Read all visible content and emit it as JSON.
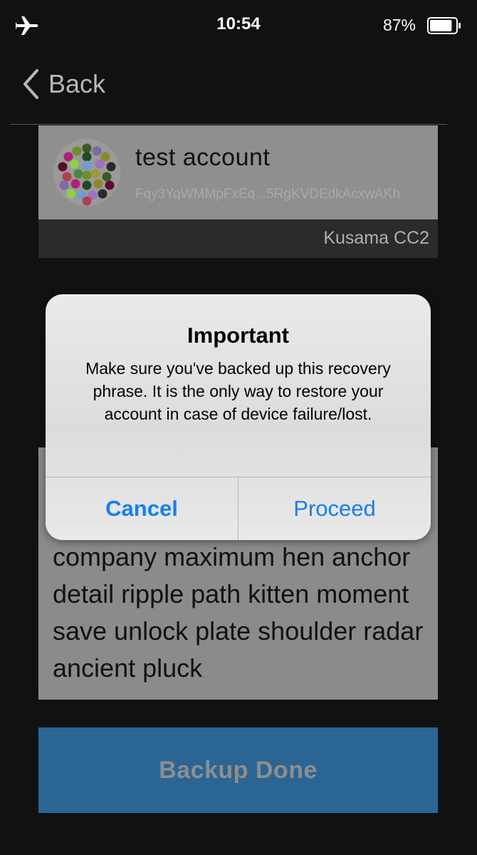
{
  "status_bar": {
    "time": "10:54",
    "battery_percent": "87%",
    "battery_level": 0.87,
    "airplane_icon": "airplane-icon"
  },
  "nav": {
    "back_label": "Back",
    "back_icon": "chevron-left-icon"
  },
  "account": {
    "name": "test account",
    "address": "Fqy3YqWMMpFxEq...5RgKVDEdkAcxwAKh",
    "network": "Kusama CC2"
  },
  "recovery_phrase": "company maximum hen anchor detail ripple path kitten moment save unlock plate shoulder radar ancient pluck",
  "backup_button": {
    "label": "Backup Done"
  },
  "alert": {
    "title": "Important",
    "message": "Make sure you've backed up this recovery phrase. It is the only way to restore your account in case of device failure/lost.",
    "cancel_label": "Cancel",
    "proceed_label": "Proceed"
  },
  "colors": {
    "background": "#111111",
    "card": "#8b8b8b",
    "primary_button": "#2a6594",
    "ios_blue": "#157efb"
  }
}
